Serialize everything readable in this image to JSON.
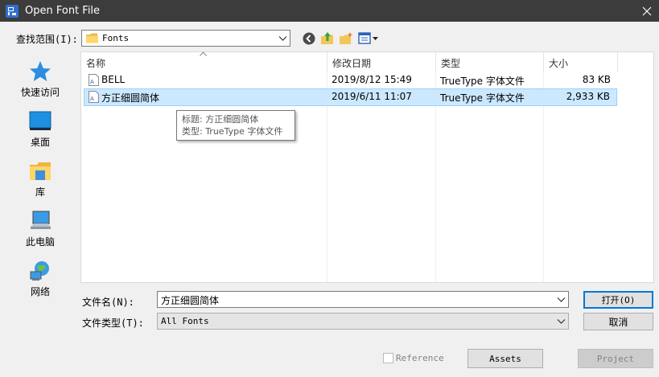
{
  "window": {
    "title": "Open Font File",
    "colors": {
      "titlebar": "#3c3c3c",
      "selection": "#cce8ff",
      "accent": "#0078d7"
    }
  },
  "lookin": {
    "label": "查找范围(I):",
    "value": "Fonts",
    "folder_icon": "folder-icon"
  },
  "toolbar": {
    "icons": [
      "back-icon",
      "up-folder-icon",
      "new-folder-icon",
      "view-menu-icon"
    ]
  },
  "places": [
    {
      "label": "快速访问",
      "icon": "star-icon"
    },
    {
      "label": "桌面",
      "icon": "desktop-icon"
    },
    {
      "label": "库",
      "icon": "library-icon"
    },
    {
      "label": "此电脑",
      "icon": "computer-icon"
    },
    {
      "label": "网络",
      "icon": "network-icon"
    }
  ],
  "list": {
    "columns": [
      "名称",
      "修改日期",
      "类型",
      "大小"
    ],
    "rows": [
      {
        "name": "BELL",
        "date": "2019/8/12 15:49",
        "type": "TrueType 字体文件",
        "size": "83 KB",
        "selected": false
      },
      {
        "name": "方正细圆简体",
        "date": "2019/6/11 11:07",
        "type": "TrueType 字体文件",
        "size": "2,933 KB",
        "selected": true
      }
    ]
  },
  "tooltip": {
    "line1": "标题: 方正细圆简体",
    "line2": "类型: TrueType 字体文件"
  },
  "filename": {
    "label": "文件名(N):",
    "value": "方正细圆简体"
  },
  "filetype": {
    "label": "文件类型(T):",
    "value": "All Fonts"
  },
  "buttons": {
    "open": "打开(O)",
    "cancel": "取消",
    "assets": "Assets",
    "project": "Project"
  },
  "reference": {
    "label": "Reference",
    "checked": false
  }
}
